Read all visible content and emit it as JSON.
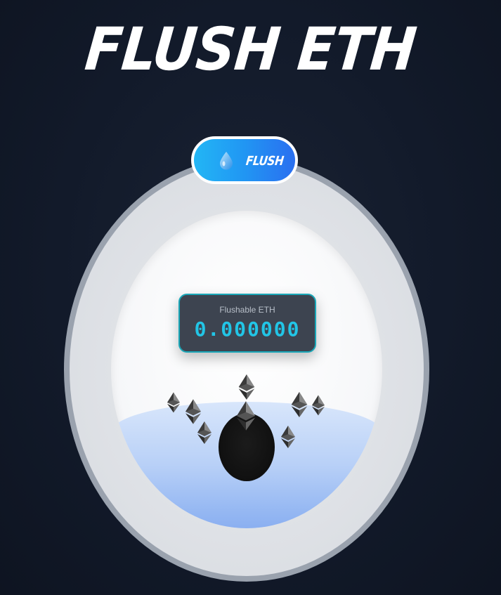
{
  "header": {
    "title": "FLUSH ETH"
  },
  "flush_button": {
    "label": "FLUSH",
    "icon": "droplet-icon"
  },
  "counter": {
    "label": "Flushable ETH",
    "value": "0.000000"
  },
  "bowl": {
    "coin_icon": "ethereum-icon",
    "drain_icon": "drain-hole"
  },
  "colors": {
    "background": "#111827",
    "accent": "#2196f3",
    "counter_value": "#22c5e6",
    "water": "#93b6f2"
  }
}
